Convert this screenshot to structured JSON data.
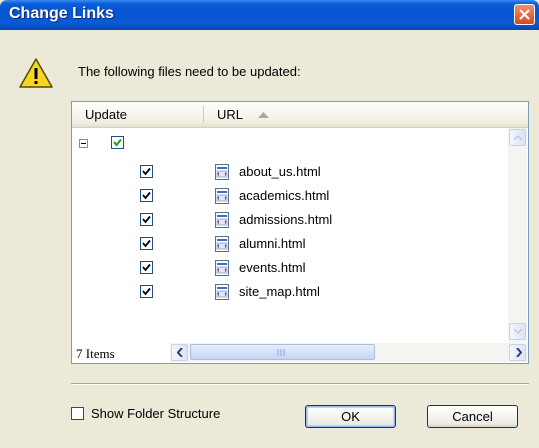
{
  "window": {
    "title": "Change Links"
  },
  "message": "The following files need to be updated:",
  "list": {
    "columns": [
      "Update",
      "URL"
    ],
    "sort_column": "URL",
    "sort_direction": "ascending",
    "root": {
      "checked": true,
      "expanded": true
    },
    "files": [
      {
        "name": "about_us.html",
        "checked": true
      },
      {
        "name": "academics.html",
        "checked": true
      },
      {
        "name": "admissions.html",
        "checked": true
      },
      {
        "name": "alumni.html",
        "checked": true
      },
      {
        "name": "events.html",
        "checked": true
      },
      {
        "name": "site_map.html",
        "checked": true
      }
    ],
    "status": "7 Items"
  },
  "show_folder_structure": {
    "label": "Show Folder Structure",
    "checked": false
  },
  "buttons": {
    "ok": "OK",
    "cancel": "Cancel"
  },
  "colors": {
    "titlebar": "#0A5AD8",
    "dialog_bg": "#ECE9D8",
    "border": "#7F9DB9"
  }
}
